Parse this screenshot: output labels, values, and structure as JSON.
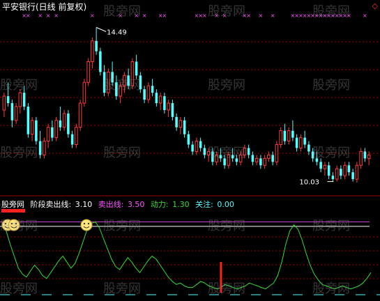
{
  "header": {
    "title": "平安银行(日线 前复权)",
    "diamond_icon": "diamond-icon"
  },
  "price_chart": {
    "high_label": "14.49",
    "low_label": "10.03"
  },
  "indicator": {
    "brand": "股旁网",
    "name_label": "阶段卖出线:",
    "name_value": "3.10",
    "sell_label": "卖出线:",
    "sell_value": "3.50",
    "power_label": "动力:",
    "power_value": "1.30",
    "watch_label": "关注:",
    "watch_value": "0.00"
  },
  "colors": {
    "up": "#ff3b3b",
    "down": "#54ffff",
    "grid": "#a00000",
    "sell_line": "#d04bd0",
    "power_line": "#33dd33",
    "name_label": "#ffffff",
    "sell_label": "#ff55ff",
    "power_label": "#33dd33",
    "watch_label": "#54ffff",
    "marker": "#ff55ff"
  },
  "watermark": "股旁网",
  "chart_data": {
    "type": "candlestick",
    "price_range": [
      9.8,
      14.8
    ],
    "candles": [
      [
        12.1,
        12.6,
        11.9,
        12.5
      ],
      [
        12.5,
        12.9,
        12.2,
        12.3
      ],
      [
        12.3,
        12.4,
        11.6,
        11.8
      ],
      [
        11.8,
        12.3,
        11.7,
        12.2
      ],
      [
        12.2,
        12.7,
        12.0,
        12.6
      ],
      [
        12.6,
        12.8,
        12.1,
        12.2
      ],
      [
        12.2,
        12.3,
        11.3,
        11.4
      ],
      [
        11.4,
        11.9,
        11.2,
        11.8
      ],
      [
        11.8,
        11.9,
        11.1,
        11.2
      ],
      [
        11.2,
        11.5,
        10.7,
        10.8
      ],
      [
        10.8,
        11.3,
        10.7,
        11.2
      ],
      [
        11.2,
        11.7,
        11.0,
        11.6
      ],
      [
        11.6,
        11.8,
        11.2,
        11.3
      ],
      [
        11.3,
        11.9,
        11.2,
        11.8
      ],
      [
        11.8,
        12.2,
        11.5,
        11.6
      ],
      [
        11.6,
        12.1,
        11.5,
        12.0
      ],
      [
        12.0,
        12.1,
        11.3,
        11.4
      ],
      [
        11.4,
        11.5,
        11.0,
        11.1
      ],
      [
        11.1,
        11.7,
        11.0,
        11.6
      ],
      [
        11.6,
        12.4,
        11.5,
        12.3
      ],
      [
        12.3,
        13.0,
        12.2,
        12.9
      ],
      [
        12.9,
        13.6,
        12.8,
        13.5
      ],
      [
        13.5,
        14.2,
        13.3,
        14.1
      ],
      [
        14.1,
        14.49,
        13.7,
        13.8
      ],
      [
        13.8,
        13.9,
        13.1,
        13.2
      ],
      [
        13.2,
        13.4,
        12.5,
        12.6
      ],
      [
        12.6,
        13.3,
        12.5,
        13.2
      ],
      [
        13.2,
        13.5,
        12.8,
        12.9
      ],
      [
        12.9,
        13.1,
        12.4,
        12.5
      ],
      [
        12.5,
        12.9,
        12.3,
        12.8
      ],
      [
        12.8,
        13.2,
        12.6,
        13.1
      ],
      [
        13.1,
        13.3,
        12.7,
        12.8
      ],
      [
        12.8,
        13.6,
        12.7,
        13.5
      ],
      [
        13.5,
        13.7,
        13.0,
        13.1
      ],
      [
        13.1,
        13.2,
        12.6,
        12.7
      ],
      [
        12.7,
        12.8,
        12.3,
        12.4
      ],
      [
        12.4,
        12.9,
        12.3,
        12.8
      ],
      [
        12.8,
        13.0,
        12.5,
        12.6
      ],
      [
        12.6,
        12.7,
        12.2,
        12.3
      ],
      [
        12.3,
        12.6,
        12.1,
        12.5
      ],
      [
        12.5,
        12.6,
        12.0,
        12.1
      ],
      [
        12.1,
        12.4,
        11.9,
        12.3
      ],
      [
        12.3,
        12.4,
        11.8,
        11.9
      ],
      [
        11.9,
        12.0,
        11.5,
        11.6
      ],
      [
        11.6,
        11.9,
        11.4,
        11.8
      ],
      [
        11.8,
        11.9,
        11.3,
        11.4
      ],
      [
        11.4,
        11.5,
        11.0,
        11.1
      ],
      [
        11.1,
        11.2,
        10.8,
        10.9
      ],
      [
        10.9,
        11.3,
        10.8,
        11.2
      ],
      [
        11.2,
        11.3,
        10.9,
        11.0
      ],
      [
        11.0,
        11.1,
        10.7,
        10.8
      ],
      [
        10.8,
        11.0,
        10.6,
        10.9
      ],
      [
        10.9,
        11.0,
        10.5,
        10.6
      ],
      [
        10.6,
        10.9,
        10.5,
        10.8
      ],
      [
        10.8,
        11.0,
        10.6,
        10.7
      ],
      [
        10.7,
        10.8,
        10.4,
        10.5
      ],
      [
        10.5,
        10.9,
        10.4,
        10.8
      ],
      [
        10.8,
        11.0,
        10.6,
        10.7
      ],
      [
        10.7,
        10.8,
        10.5,
        10.6
      ],
      [
        10.6,
        10.9,
        10.5,
        10.8
      ],
      [
        10.8,
        11.1,
        10.7,
        11.0
      ],
      [
        11.0,
        11.1,
        10.7,
        10.8
      ],
      [
        10.8,
        10.9,
        10.5,
        10.6
      ],
      [
        10.6,
        10.8,
        10.5,
        10.7
      ],
      [
        10.7,
        10.8,
        10.4,
        10.5
      ],
      [
        10.5,
        10.8,
        10.4,
        10.7
      ],
      [
        10.7,
        10.9,
        10.6,
        10.8
      ],
      [
        10.8,
        10.9,
        10.5,
        10.6
      ],
      [
        10.6,
        11.2,
        10.5,
        11.1
      ],
      [
        11.1,
        11.6,
        11.0,
        11.5
      ],
      [
        11.5,
        11.7,
        11.1,
        11.2
      ],
      [
        11.2,
        11.6,
        11.1,
        11.5
      ],
      [
        11.5,
        11.8,
        11.2,
        11.3
      ],
      [
        11.3,
        11.4,
        10.9,
        11.0
      ],
      [
        11.0,
        11.4,
        10.9,
        11.3
      ],
      [
        11.3,
        11.5,
        11.0,
        11.1
      ],
      [
        11.1,
        11.2,
        10.8,
        10.9
      ],
      [
        10.9,
        11.0,
        10.6,
        10.7
      ],
      [
        10.7,
        10.9,
        10.5,
        10.6
      ],
      [
        10.6,
        10.7,
        10.3,
        10.4
      ],
      [
        10.4,
        10.6,
        10.2,
        10.5
      ],
      [
        10.5,
        10.6,
        10.1,
        10.2
      ],
      [
        10.2,
        10.3,
        10.03,
        10.1
      ],
      [
        10.1,
        10.5,
        10.03,
        10.4
      ],
      [
        10.4,
        10.5,
        10.1,
        10.2
      ],
      [
        10.2,
        10.6,
        10.1,
        10.5
      ],
      [
        10.5,
        10.6,
        10.2,
        10.3
      ],
      [
        10.3,
        10.4,
        10.03,
        10.1
      ],
      [
        10.1,
        10.6,
        10.0,
        10.5
      ],
      [
        10.5,
        11.0,
        10.4,
        10.9
      ],
      [
        10.9,
        11.0,
        10.6,
        10.7
      ],
      [
        10.7,
        10.9,
        10.5,
        10.8
      ]
    ],
    "indicator_series": {
      "name": "动力",
      "range": [
        0,
        5
      ],
      "values": [
        4.4,
        4.1,
        3.2,
        2.4,
        1.6,
        1.2,
        1.0,
        1.4,
        1.8,
        1.5,
        1.1,
        0.9,
        1.3,
        1.7,
        2.1,
        2.4,
        2.0,
        1.6,
        1.9,
        2.6,
        3.4,
        4.2,
        4.6,
        4.7,
        4.3,
        3.6,
        2.9,
        2.2,
        1.7,
        1.5,
        1.9,
        2.3,
        2.0,
        1.6,
        1.3,
        1.7,
        2.1,
        2.4,
        2.2,
        1.8,
        1.4,
        1.0,
        0.7,
        0.5,
        0.6,
        0.4,
        0.3,
        0.3,
        0.5,
        0.7,
        0.6,
        0.4,
        0.3,
        0.2,
        0.3,
        0.5,
        0.4,
        0.3,
        0.2,
        0.3,
        0.4,
        0.6,
        0.5,
        0.4,
        0.3,
        0.2,
        0.4,
        0.6,
        1.1,
        2.0,
        3.2,
        4.1,
        4.5,
        4.2,
        3.5,
        2.6,
        1.8,
        1.2,
        0.8,
        0.5,
        0.4,
        0.3,
        0.2,
        0.3,
        0.4,
        0.3,
        0.2,
        0.3,
        0.4,
        0.6,
        0.9,
        1.3
      ]
    },
    "sell_signal_index": 54,
    "top_markers": [
      5,
      6,
      9,
      11,
      13,
      22,
      29,
      33,
      35,
      39,
      40,
      48,
      49,
      50,
      53,
      55,
      60,
      61,
      64,
      67,
      72,
      73,
      74,
      75,
      76,
      77,
      78,
      79,
      80,
      81,
      82,
      83,
      84,
      85,
      86,
      90
    ]
  }
}
